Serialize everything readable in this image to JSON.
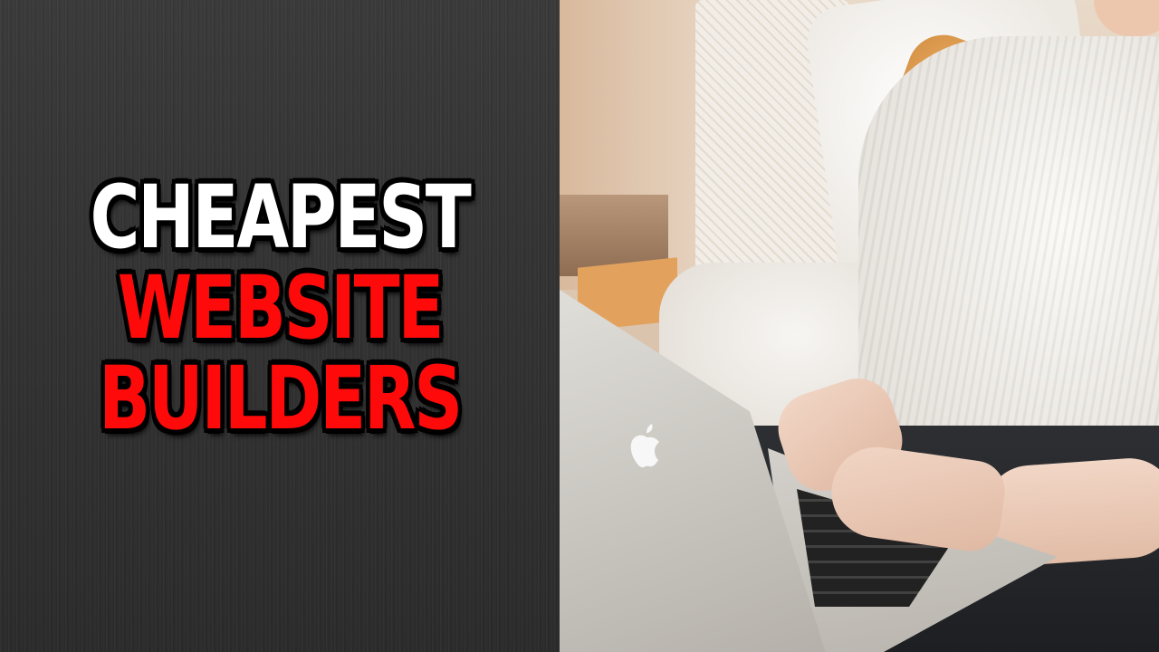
{
  "title": {
    "line1": "CHEAPEST",
    "line2": "WEBSITE",
    "line3": "BUILDERS"
  },
  "colors": {
    "line1": "#ffffff",
    "line2_line3": "#ff0a0a",
    "outline": "#000000",
    "panel": "#333333"
  },
  "photo": {
    "icon": "apple-logo-icon"
  }
}
